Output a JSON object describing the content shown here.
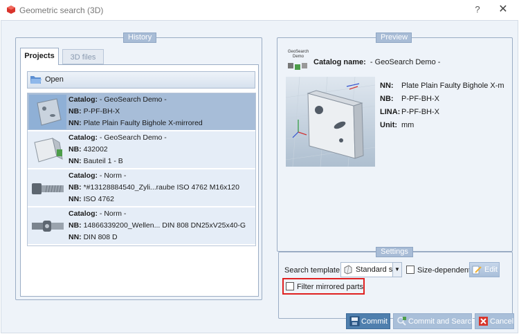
{
  "window": {
    "title": "Geometric search (3D)",
    "help_glyph": "?",
    "close_glyph": "✕"
  },
  "history": {
    "title": "History",
    "tabs": [
      {
        "label": "Projects",
        "active": true
      },
      {
        "label": "3D files",
        "active": false
      }
    ],
    "open_label": "Open",
    "results": [
      {
        "catalog_key": "Catalog:",
        "catalog": "- GeoSearch Demo -",
        "nb_key": "NB:",
        "nb": "P-PF-BH-X",
        "nn_key": "NN:",
        "nn": "Plate Plain Faulty Bighole X-mirrored",
        "selected": true,
        "icon": "plate-thumbnail"
      },
      {
        "catalog_key": "Catalog:",
        "catalog": "- GeoSearch Demo -",
        "nb_key": "NB:",
        "nb": "432002",
        "nn_key": "NN:",
        "nn": "Bauteil 1 - B",
        "selected": false,
        "icon": "bracket-thumbnail"
      },
      {
        "catalog_key": "Catalog:",
        "catalog": "- Norm -",
        "nb_key": "NB:",
        "nb": "*#13128884540_Zyli...raube ISO 4762 M16x120",
        "nn_key": "NN:",
        "nn": "ISO 4762",
        "selected": false,
        "icon": "screw-thumbnail"
      },
      {
        "catalog_key": "Catalog:",
        "catalog": "- Norm -",
        "nb_key": "NB:",
        "nb": "14866339200_Wellen... DIN 808 DN25xV25x40-G",
        "nn_key": "NN:",
        "nn": "DIN 808 D",
        "selected": false,
        "icon": "joint-thumbnail"
      }
    ]
  },
  "preview": {
    "title": "Preview",
    "logo_text": "GeoSearch Demo",
    "catalog_key": "Catalog name:",
    "catalog_value": "- GeoSearch Demo -",
    "fields": [
      {
        "key": "NN:",
        "value": "Plate Plain Faulty Bighole X-m"
      },
      {
        "key": "NB:",
        "value": "P-PF-BH-X"
      },
      {
        "key": "LINA:",
        "value": "P-PF-BH-X"
      },
      {
        "key": "Unit:",
        "value": "mm"
      }
    ]
  },
  "settings": {
    "title": "Settings",
    "search_template_label": "Search template:",
    "search_template_value": "Standard se",
    "size_dependent_label": "Size-dependent",
    "size_dependent_checked": false,
    "edit_label": "Edit",
    "filter_mirrored_label": "Filter mirrored parts",
    "filter_mirrored_checked": false,
    "highlight_color": "#e02020"
  },
  "buttons": {
    "commit": "Commit",
    "commit_and_search": "Commit and Search",
    "cancel": "Cancel"
  },
  "colors": {
    "accent": "#4f7fae",
    "selected_row": "#a7bdd8",
    "row": "#e5edf7",
    "group_title": "#a8bcd6"
  }
}
